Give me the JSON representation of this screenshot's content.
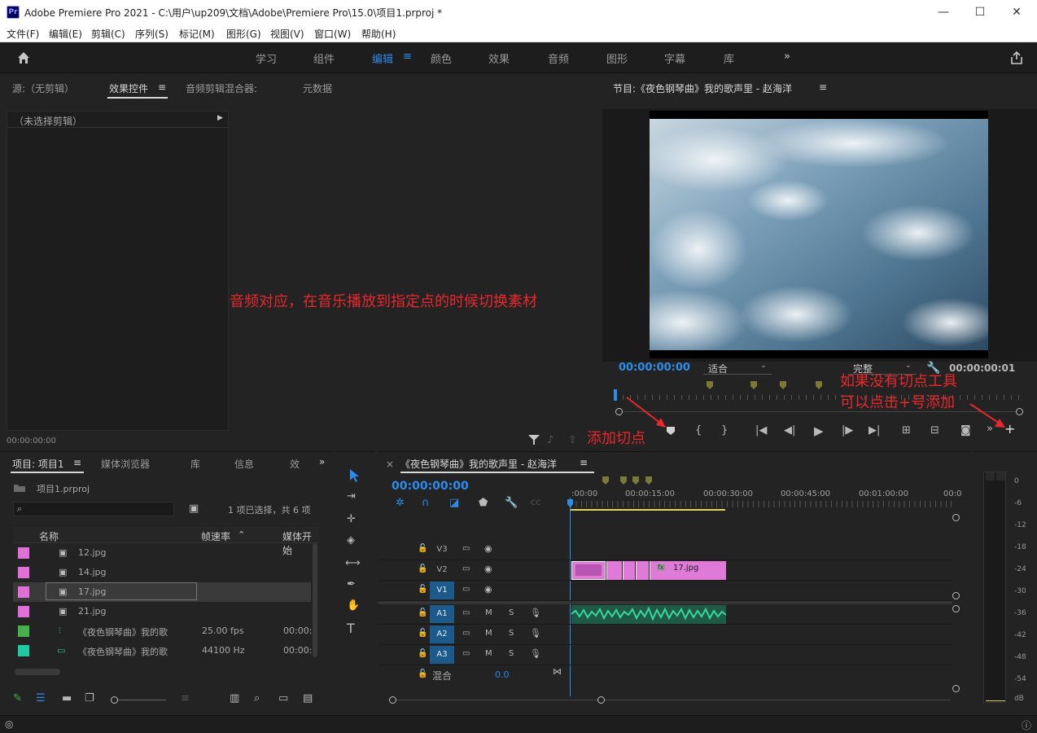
{
  "window": {
    "title": "Adobe Premiere Pro 2021 - C:\\用户\\up209\\文档\\Adobe\\Premiere Pro\\15.0\\项目1.prproj *",
    "logo": "Pr",
    "controls": {
      "minimize": "—",
      "maximize": "☐",
      "close": "✕"
    }
  },
  "menu": [
    "文件(F)",
    "编辑(E)",
    "剪辑(C)",
    "序列(S)",
    "标记(M)",
    "图形(G)",
    "视图(V)",
    "窗口(W)",
    "帮助(H)"
  ],
  "workspaces": {
    "items": [
      "学习",
      "组件",
      "编辑",
      "颜色",
      "效果",
      "音频",
      "图形",
      "字幕",
      "库"
    ],
    "active": "编辑",
    "more": "»"
  },
  "source_panel": {
    "tabs": [
      "源:（无剪辑）",
      "效果控件",
      "音频剪辑混合器:",
      "元数据"
    ],
    "active_tab": "效果控件",
    "no_clip": "（未选择剪辑）",
    "timecode": "00:00:00:00"
  },
  "program_panel": {
    "title": "节目:《夜色钢琴曲》我的歌声里 - 赵海洋",
    "timecode_left": "00:00:00:00",
    "fit": "适合",
    "quality": "完整",
    "timecode_right": "00:00:00:01"
  },
  "annotations": {
    "main": "音频对应，在音乐播放到指定点的时候切换素材",
    "add_marker": "添加切点",
    "hint_line1": "如果没有切点工具",
    "hint_line2": "可以点击+号添加"
  },
  "project_panel": {
    "tabs": [
      "项目: 项目1",
      "媒体浏览器",
      "库",
      "信息",
      "效"
    ],
    "active_tab": "项目: 项目1",
    "file": "项目1.prproj",
    "search_placeholder": "",
    "selection_info": "1 项已选择，共 6 项",
    "columns": [
      "名称",
      "帧速率",
      "媒体开始"
    ],
    "items": [
      {
        "name": "12.jpg",
        "fps": "",
        "start": "",
        "color": "#e070d8",
        "selected": false
      },
      {
        "name": "14.jpg",
        "fps": "",
        "start": "",
        "color": "#e070d8",
        "selected": false
      },
      {
        "name": "17.jpg",
        "fps": "",
        "start": "",
        "color": "#e070d8",
        "selected": true
      },
      {
        "name": "21.jpg",
        "fps": "",
        "start": "",
        "color": "#e070d8",
        "selected": false
      },
      {
        "name": "《夜色钢琴曲》我的歌",
        "fps": "25.00 fps",
        "start": "00:00:0",
        "color": "#46b04a",
        "selected": false
      },
      {
        "name": "《夜色钢琴曲》我的歌",
        "fps": "44100 Hz",
        "start": "00:00:0",
        "color": "#20c9a0",
        "selected": false
      }
    ]
  },
  "timeline": {
    "title": "《夜色钢琴曲》我的歌声里 - 赵海洋",
    "timecode": "00:00:00:00",
    "ruler": [
      ":00:00",
      "00:00:15:00",
      "00:00:30:00",
      "00:00:45:00",
      "00:01:00:00",
      "00:0"
    ],
    "tracks": [
      {
        "name": "V3",
        "on": false
      },
      {
        "name": "V2",
        "on": false
      },
      {
        "name": "V1",
        "on": true
      },
      {
        "name": "A1",
        "on": true
      },
      {
        "name": "A2",
        "on": true
      },
      {
        "name": "A3",
        "on": true
      }
    ],
    "mix_label": "混合",
    "mix_value": "0.0",
    "clip_label": "17.jpg",
    "m_label": "M",
    "s_label": "S"
  },
  "meter": {
    "labels": [
      "0",
      "-6",
      "-12",
      "-18",
      "-24",
      "-30",
      "-36",
      "-42",
      "-48",
      "-54",
      "dB"
    ]
  }
}
